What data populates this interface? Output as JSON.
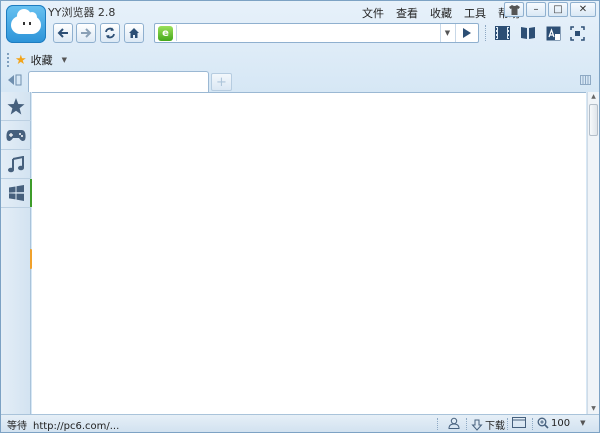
{
  "window": {
    "title": "YY浏览器 2.8",
    "accent_color": "#2c93d8",
    "border_color": "#7da2c4"
  },
  "menu": [
    "文件",
    "查看",
    "收藏",
    "工具",
    "帮助"
  ],
  "window_buttons": [
    {
      "name": "skin-button",
      "icon": "shirt-icon",
      "glyph": "👕"
    },
    {
      "name": "minimize-button",
      "icon": "minimize-icon",
      "glyph": "–"
    },
    {
      "name": "maximize-button",
      "icon": "maximize-icon",
      "glyph": "□"
    },
    {
      "name": "close-button",
      "icon": "close-icon",
      "glyph": "✕"
    }
  ],
  "nav": {
    "back_icon": "arrow-left-icon",
    "forward_icon": "arrow-right-icon",
    "refresh_icon": "refresh-icon",
    "home_icon": "home-icon"
  },
  "address": {
    "value": "",
    "placeholder": "",
    "site_icon": "ie-compat-icon",
    "dropdown_icon": "chevron-down-icon",
    "go_icon": "play-icon"
  },
  "toolbar_icons": [
    "video-icon",
    "reader-icon",
    "translate-icon",
    "screenshot-icon"
  ],
  "bookmarks": {
    "label": "收藏",
    "icon": "star-icon"
  },
  "tabs": [
    {
      "label": ""
    }
  ],
  "new_tab_glyph": "+",
  "sidebar": [
    "favorites-star-icon",
    "gamepad-icon",
    "music-note-icon",
    "windows-logo-icon"
  ],
  "status": {
    "text": "等待",
    "url": "http://pc6.com/...",
    "download_label": "下载",
    "zoom": "100"
  }
}
